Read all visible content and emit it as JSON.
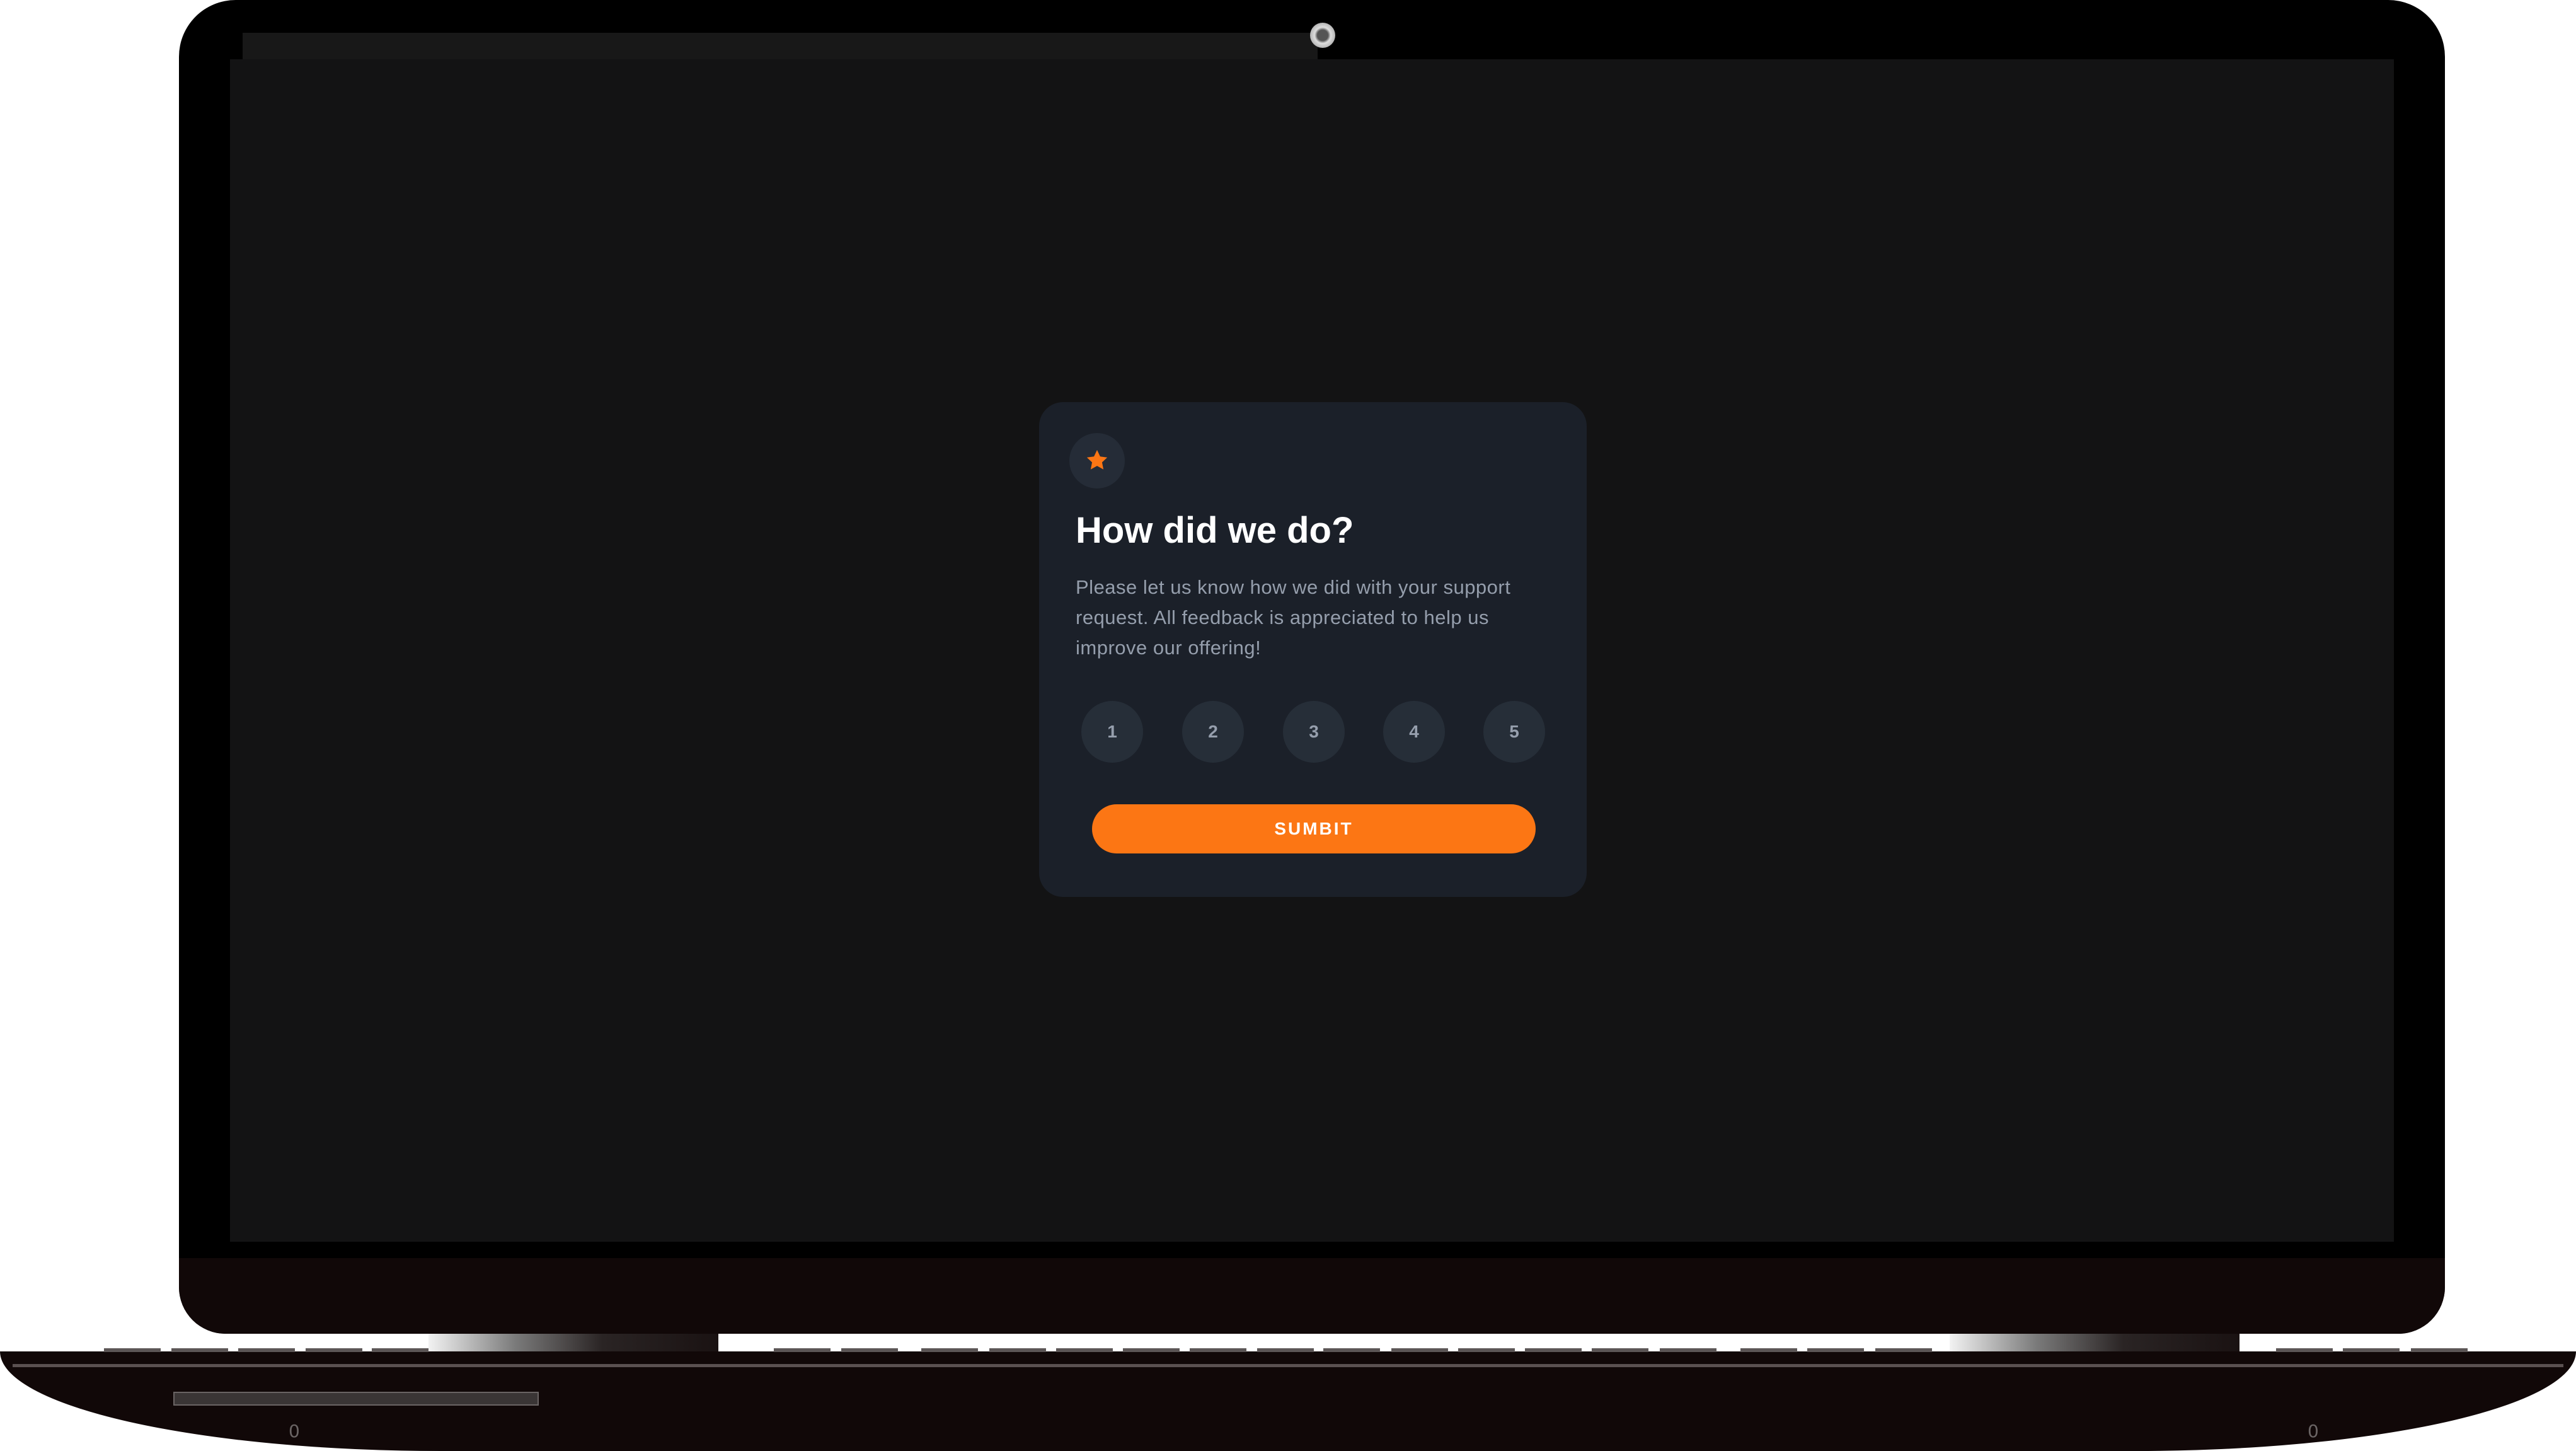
{
  "card": {
    "icon": "star-icon",
    "title": "How did we do?",
    "description": "Please let us know how we did with your support request. All feedback is appreciated to help us improve our offering!",
    "ratings": [
      "1",
      "2",
      "3",
      "4",
      "5"
    ],
    "submit_label": "SUMBIT"
  },
  "colors": {
    "accent": "#fc7614",
    "card_background": "#1b2029",
    "screen_background": "#131314",
    "rating_background": "#262e38",
    "text_muted": "#959eac"
  },
  "device": {
    "left_label": "0",
    "right_label": "0"
  }
}
